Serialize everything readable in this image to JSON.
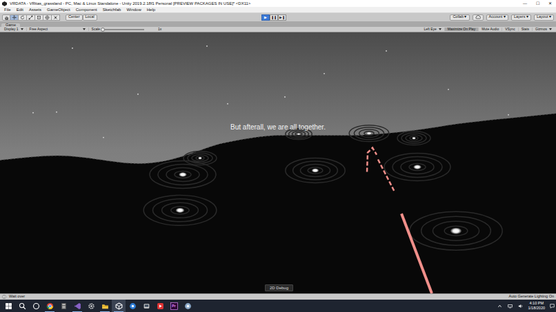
{
  "window": {
    "title": "VRDATA - VRitas_grassland - PC, Mac & Linux Standalone - Unity 2019.2.18f1 Personal [PREVIEW PACKAGES IN USE]* <DX11>",
    "controls": [
      "—",
      "☐",
      "✕"
    ]
  },
  "menu": [
    "File",
    "Edit",
    "Assets",
    "GameObject",
    "Component",
    "Sketchfab",
    "Window",
    "Help"
  ],
  "toolbar": {
    "tools": [
      {
        "selected": false
      },
      {
        "selected": true
      },
      {
        "selected": false
      },
      {
        "selected": false
      },
      {
        "selected": false
      },
      {
        "selected": false
      },
      {
        "selected": false
      }
    ],
    "pivot": "Center",
    "handle": "Local",
    "playback": [
      {
        "icon": "▶",
        "selected": true
      },
      {
        "icon": "❚❚",
        "selected": false
      },
      {
        "icon": "▶❚",
        "selected": false
      }
    ],
    "collab": "Collab ▾",
    "account": "Account ▾",
    "layers": "Layers ▾",
    "layout": "Layout ▾"
  },
  "game_tab": {
    "label": "Game",
    "selected": true
  },
  "game_toolbar": {
    "display": "Display 1",
    "aspect": "Free Aspect",
    "scale_label": "Scale",
    "scale_level": 0.0,
    "scale_reading": "1x",
    "eye": "Left Eye",
    "toggles": [
      {
        "label": "Maximize On Play",
        "selected": true
      },
      {
        "label": "Mute Audio",
        "selected": false
      },
      {
        "label": "VSync",
        "selected": false
      },
      {
        "label": "Stats",
        "selected": false
      }
    ],
    "gizmos": "Gizmos"
  },
  "game_view": {
    "subtitle": "But afterall, we are all together.",
    "debug_button": "2D Debug"
  },
  "status_bar": {
    "message": "Wait over",
    "lighting": "Auto Generate Lighting On"
  },
  "taskbar": {
    "apps": [
      {
        "label": "",
        "open": false,
        "selected": false
      },
      {
        "label": "",
        "open": false,
        "selected": false
      },
      {
        "label": "",
        "open": false,
        "selected": false
      },
      {
        "label": "",
        "open": true,
        "selected": false
      },
      {
        "label": "",
        "open": false,
        "selected": false
      },
      {
        "label": "",
        "open": true,
        "selected": false
      },
      {
        "label": "",
        "open": false,
        "selected": false
      },
      {
        "label": "",
        "open": true,
        "selected": false
      },
      {
        "label": "",
        "open": true,
        "selected": true
      },
      {
        "label": "",
        "open": false,
        "selected": false
      },
      {
        "label": "",
        "open": false,
        "selected": false
      },
      {
        "label": "",
        "open": false,
        "selected": false
      },
      {
        "label": "Pr",
        "open": false,
        "selected": false
      },
      {
        "label": "",
        "open": false,
        "selected": false
      }
    ],
    "time": "4:10 PM",
    "date": "1/18/2020"
  }
}
